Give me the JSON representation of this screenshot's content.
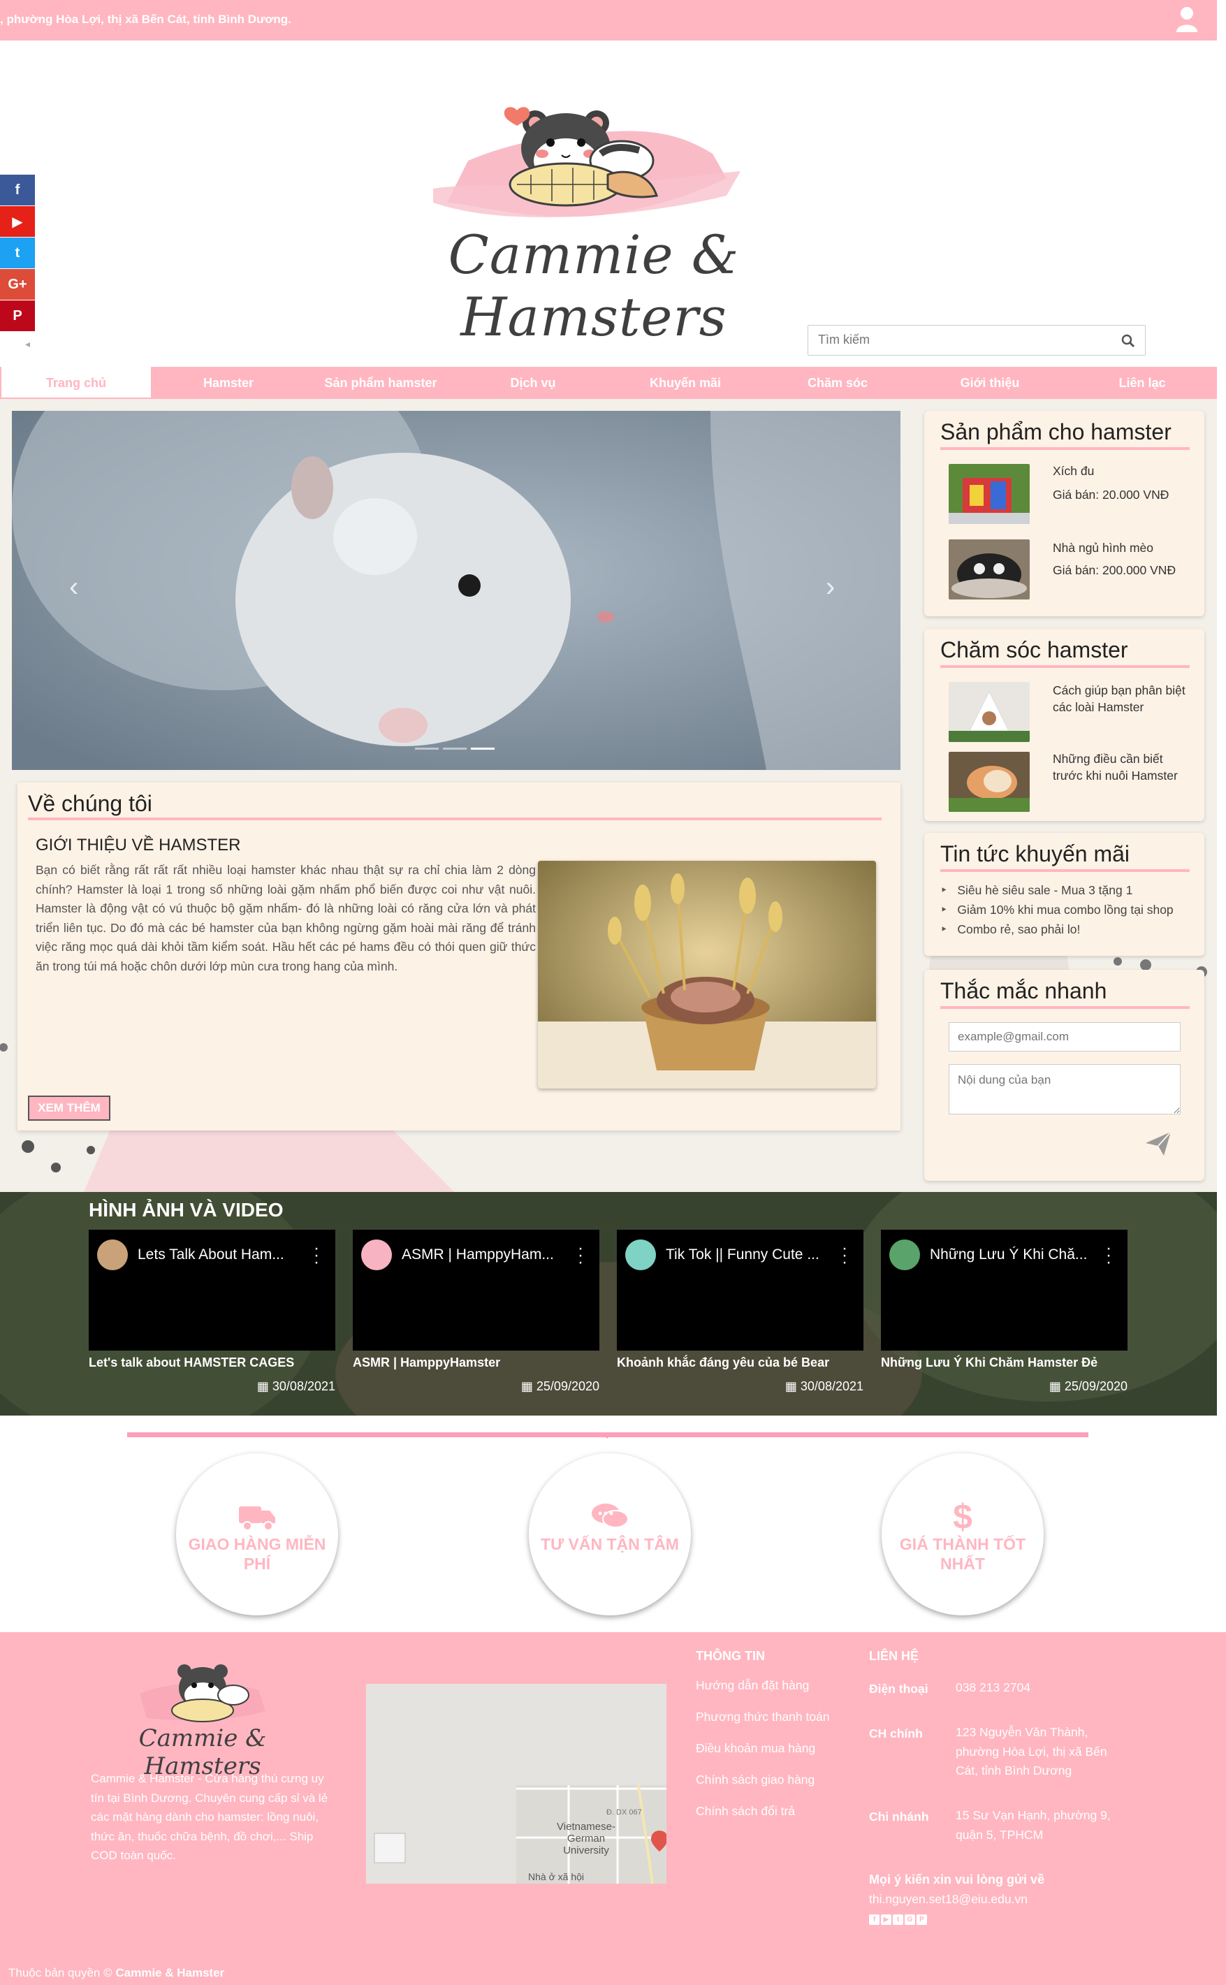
{
  "topbar": {
    "address": ", phường Hòa Lợi, thị xã Bến Cát, tỉnh Bình Dương."
  },
  "social": [
    {
      "name": "facebook",
      "glyph": "f",
      "color": "#3b5998"
    },
    {
      "name": "youtube",
      "glyph": "▶",
      "color": "#e62117"
    },
    {
      "name": "twitter",
      "glyph": "t",
      "color": "#1da1f2"
    },
    {
      "name": "google-plus",
      "glyph": "G+",
      "color": "#dd4b39"
    },
    {
      "name": "pinterest",
      "glyph": "P",
      "color": "#bd081c"
    }
  ],
  "logo": {
    "text": "Cammie & Hamsters"
  },
  "search": {
    "placeholder": "Tìm kiếm"
  },
  "nav": {
    "items": [
      "Trang chủ",
      "Hamster",
      "Sản phẩm hamster",
      "Dịch vụ",
      "Khuyến mãi",
      "Chăm sóc",
      "Giới thiệu",
      "Liên lạc"
    ],
    "active_index": 0
  },
  "carousel": {
    "prev": "‹",
    "next": "›",
    "slide_count": 3,
    "active_slide": 3
  },
  "about": {
    "title": "Về chúng tôi",
    "subtitle": "GIỚI THIỆU VỀ HAMSTER",
    "text": "Bạn có biết rằng rất rất rất nhiều loại hamster khác nhau thật sự ra chỉ chia làm 2 dòng chính? Hamster là loại 1 trong số những loài gặm nhấm phổ biến được coi như vật nuôi. Hamster là động vật có vú thuộc bộ gặm nhấm- đó là những loài có răng cửa lớn và phát triển liên tục. Do đó mà các bé hamster của bạn không ngừng gặm hoài mài răng để tránh việc răng mọc quá dài khỏi tầm kiểm soát. Hầu hết các pé hams đều có thói quen giữ thức ăn trong túi má hoặc chôn dưới lớp mùn cưa trong hang của mình.",
    "more_button": "XEM THÊM"
  },
  "products": {
    "title": "Sản phẩm cho hamster",
    "items": [
      {
        "name": "Xích đu",
        "price": "Giá bán: 20.000 VNĐ"
      },
      {
        "name": "Nhà ngủ hình mèo",
        "price": "Giá bán: 200.000 VNĐ"
      }
    ]
  },
  "care": {
    "title": "Chăm sóc hamster",
    "items": [
      {
        "name": "Cách giúp bạn phân biệt các loài Hamster"
      },
      {
        "name": "Những điều cần biết trước khi nuôi Hamster"
      }
    ]
  },
  "promo": {
    "title": "Tin tức khuyến mãi",
    "items": [
      "Siêu hè siêu sale - Mua 3 tặng 1",
      "Giảm 10% khi mua combo lồng tại shop",
      "Combo rẻ, sao phải lo!"
    ]
  },
  "qa": {
    "title": "Thắc mắc nhanh",
    "email_placeholder": "example@gmail.com",
    "message_placeholder": "Nội dung của bạn"
  },
  "media": {
    "title": "HÌNH ẢNH VÀ VIDEO",
    "videos": [
      {
        "title": "Lets Talk About Ham...",
        "caption": "Let's talk about HAMSTER CAGES",
        "date": "30/08/2021",
        "avatar_color": "#c9a27a"
      },
      {
        "title": "ASMR | HamppyHam...",
        "caption": "ASMR | HamppyHamster",
        "date": "25/09/2020",
        "avatar_color": "#f7b3c2"
      },
      {
        "title": "Tik Tok || Funny Cute ...",
        "caption": "Khoảnh khắc đáng yêu của bé Bear",
        "date": "30/08/2021",
        "avatar_color": "#7fd3c4"
      },
      {
        "title": "Những Lưu Ý Khi Chă...",
        "caption": "Những Lưu Ý Khi Chăm Hamster Đẻ",
        "date": "25/09/2020",
        "avatar_color": "#5aa36a"
      }
    ]
  },
  "features": [
    {
      "label": "GIAO HÀNG MIỄN PHÍ",
      "icon": "truck-icon"
    },
    {
      "label": "TƯ VẤN TẬN TÂM",
      "icon": "chat-icon"
    },
    {
      "label": "GIÁ THÀNH TỐT NHẤT",
      "icon": "dollar-icon"
    }
  ],
  "footer": {
    "logo_text": "Cammie & Hamsters",
    "description": "Cammie & Hamster - Cửa hàng thú cưng uy tín tại Bình Dương. Chuyên cung cấp sỉ và lẻ các mặt hàng dành cho hamster: lồng nuôi, thức ăn, thuốc chữa bệnh, đồ chơi,... Ship COD toàn quốc.",
    "map_label": "Vietnamese-German University",
    "map_label2": "Nhà ở xã hội",
    "map_road": "Đ. DX 067",
    "info_title": "THÔNG TIN",
    "info_links": [
      "Hướng dẫn đặt hàng",
      "Phương thức thanh toán",
      "Điều khoản mua hàng",
      "Chính sách giao hàng",
      "Chính sách đổi trả"
    ],
    "contact_title": "LIÊN HỆ",
    "phone_label": "Điện thoại",
    "phone": "038 213 2704",
    "main_label": "CH chính",
    "main_addr": "123 Nguyễn Văn Thành, phường Hòa Lợi, thị xã Bến Cát, tỉnh Bình Dương",
    "branch_label": "Chi nhánh",
    "branch_addr": "15 Sư Vạn Hạnh, phường 9, quận 5, TPHCM",
    "feedback_note": "Mọi ý kiến xin vui lòng gửi về",
    "email": "thi.nguyen.set18@eiu.edu.vn",
    "social_glyphs": [
      "f",
      "▶",
      "t",
      "G",
      "P"
    ],
    "copyright_prefix": "Thuộc bản quyền ©",
    "copyright_brand": "Cammie & Hamster"
  },
  "colors": {
    "brand_pink": "#ffb6c1",
    "card_bg": "#fdf2e6"
  }
}
